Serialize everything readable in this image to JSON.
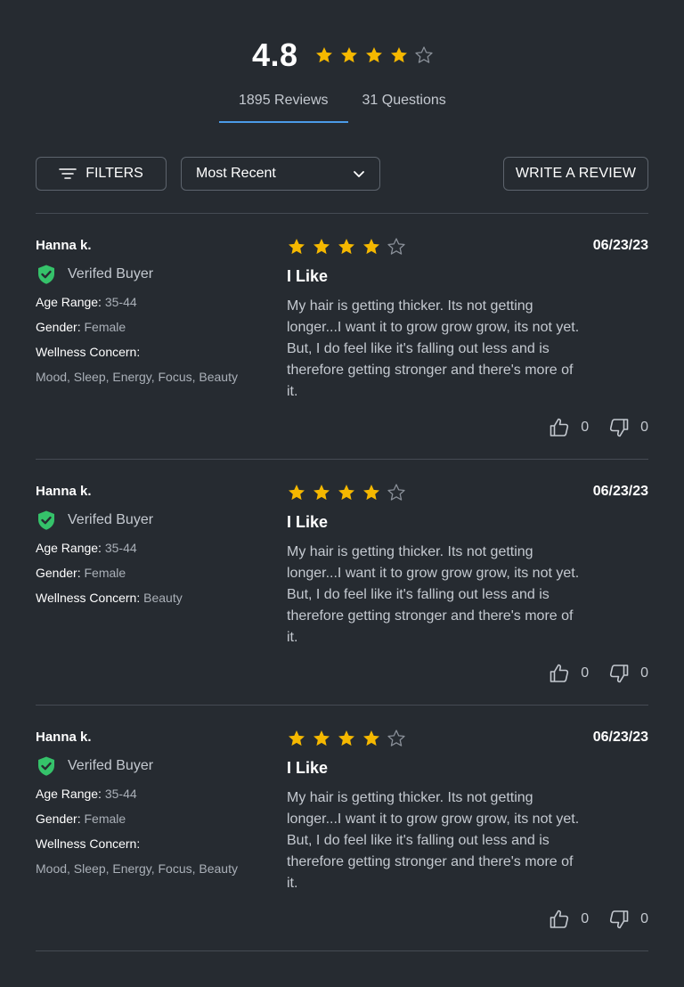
{
  "summary": {
    "average": "4.8",
    "rating": 4,
    "max_rating": 5
  },
  "tabs": [
    {
      "label": "1895 Reviews",
      "active": true
    },
    {
      "label": "31 Questions",
      "active": false
    }
  ],
  "toolbar": {
    "filters_label": "FILTERS",
    "sort_value": "Most Recent",
    "write_label": "WRITE A REVIEW"
  },
  "colors": {
    "background": "#262b31",
    "star": "#f5b800",
    "star_empty": "#8a9099",
    "verified_green": "#35c26a",
    "tab_underline": "#4b9be8"
  },
  "reviews": [
    {
      "name": "Hanna k.",
      "verified_label": "Verifed Buyer",
      "age_label": "Age Range:",
      "age_value": "35-44",
      "gender_label": "Gender:",
      "gender_value": "Female",
      "concern_label": "Wellness Concern:",
      "concern_value": "Mood, Sleep, Energy, Focus, Beauty",
      "rating": 4,
      "title": "I Like",
      "body": "My hair is getting thicker. Its not getting longer...I want it to grow grow grow, its not yet. But, I do feel like it's falling out less and is therefore getting stronger and there's more of it.",
      "date": "06/23/23",
      "helpful": "0",
      "unhelpful": "0"
    },
    {
      "name": "Hanna k.",
      "verified_label": "Verifed Buyer",
      "age_label": "Age Range:",
      "age_value": "35-44",
      "gender_label": "Gender:",
      "gender_value": "Female",
      "concern_label": "Wellness Concern:",
      "concern_value": "Beauty",
      "rating": 4,
      "title": "I Like",
      "body": "My hair is getting thicker. Its not getting longer...I want it to grow grow grow, its not yet. But, I do feel like it's falling out less and is therefore getting stronger and there's more of it.",
      "date": "06/23/23",
      "helpful": "0",
      "unhelpful": "0"
    },
    {
      "name": "Hanna k.",
      "verified_label": "Verifed Buyer",
      "age_label": "Age Range:",
      "age_value": "35-44",
      "gender_label": "Gender:",
      "gender_value": "Female",
      "concern_label": "Wellness Concern:",
      "concern_value": "Mood, Sleep, Energy, Focus, Beauty",
      "rating": 4,
      "title": "I Like",
      "body": "My hair is getting thicker. Its not getting longer...I want it to grow grow grow, its not yet. But, I do feel like it's falling out less and is therefore getting stronger and there's more of it.",
      "date": "06/23/23",
      "helpful": "0",
      "unhelpful": "0"
    }
  ]
}
